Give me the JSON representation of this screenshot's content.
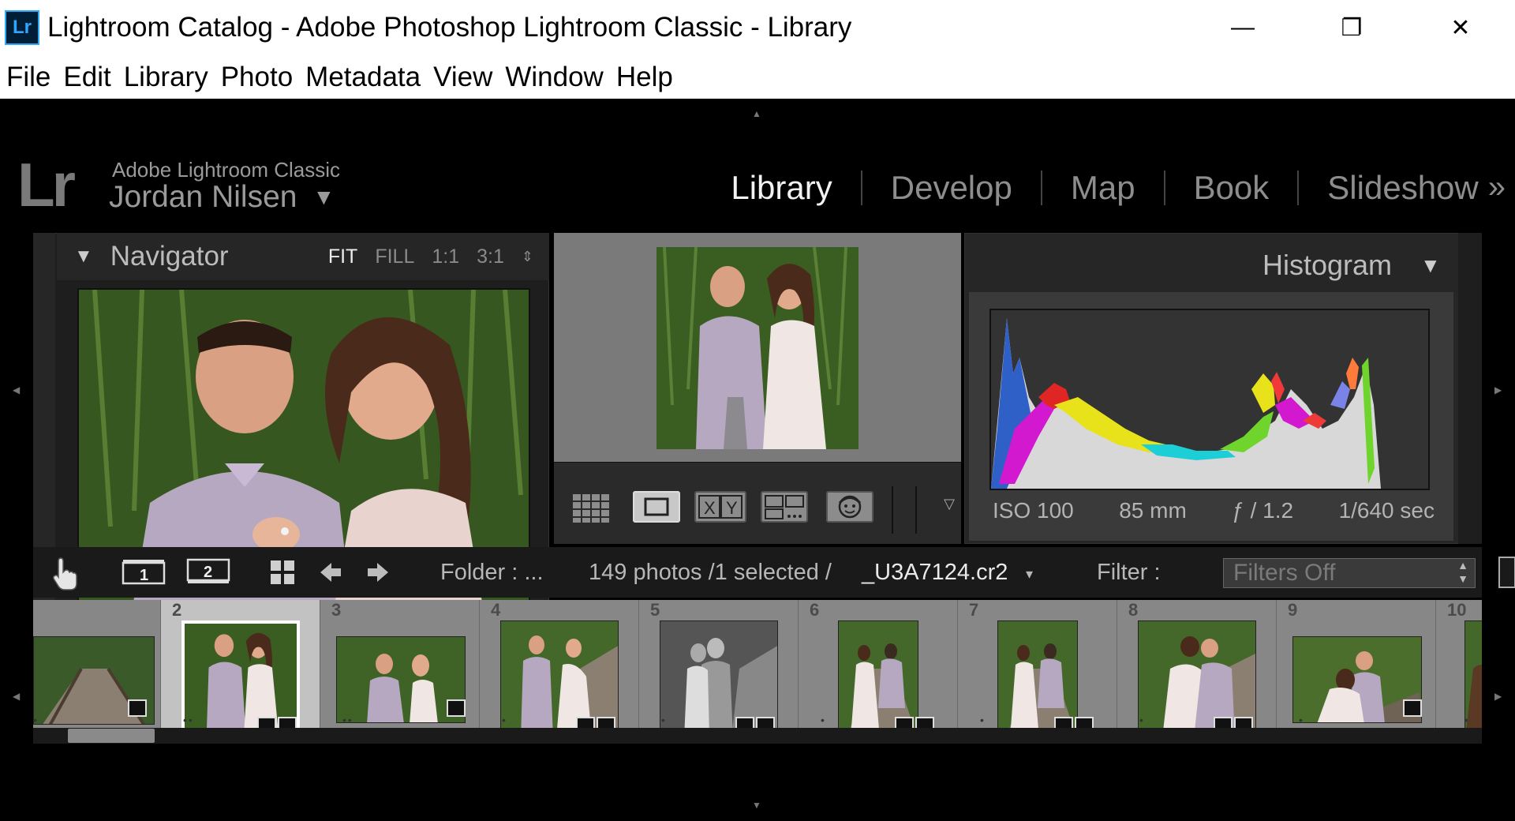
{
  "window": {
    "app_icon_text": "Lr",
    "title": "Lightroom Catalog - Adobe Photoshop Lightroom Classic - Library",
    "minimize": "—",
    "restore": "❐",
    "close": "✕"
  },
  "menu": [
    "File",
    "Edit",
    "Library",
    "Photo",
    "Metadata",
    "View",
    "Window",
    "Help"
  ],
  "identity": {
    "logo": "Lr",
    "product": "Adobe Lightroom Classic",
    "user": "Jordan Nilsen",
    "user_caret": "▼"
  },
  "modules": {
    "items": [
      "Library",
      "Develop",
      "Map",
      "Book",
      "Slideshow"
    ],
    "active": "Library",
    "more": "»"
  },
  "navigator": {
    "title": "Navigator",
    "collapse": "▼",
    "zoom": [
      "FIT",
      "FILL",
      "1:1",
      "3:1"
    ],
    "zoom_active": "FIT",
    "zoom_stepper": "⇕"
  },
  "histogram": {
    "title": "Histogram",
    "collapse": "▼",
    "iso": "ISO 100",
    "focal": "85 mm",
    "aperture": "ƒ / 1.2",
    "shutter": "1/640 sec"
  },
  "filmstrip_bar": {
    "page1": "1",
    "page2": "2",
    "folder": "Folder : ...",
    "count": "149 photos /1 selected /",
    "filename": "_U3A7124.cr2",
    "filename_caret": "▾",
    "filter_label": "Filter :",
    "filter_value": "Filters Off"
  },
  "filmstrip": {
    "cells": [
      {
        "num": "",
        "dots": "•",
        "badges": 1
      },
      {
        "num": "2",
        "dots": "••",
        "badges": 2,
        "selected": true
      },
      {
        "num": "3",
        "dots": "••",
        "badges": 1
      },
      {
        "num": "4",
        "dots": "•",
        "badges": 2
      },
      {
        "num": "5",
        "dots": "•",
        "badges": 2
      },
      {
        "num": "6",
        "dots": "•",
        "badges": 2
      },
      {
        "num": "7",
        "dots": "•",
        "badges": 2
      },
      {
        "num": "8",
        "dots": "•",
        "badges": 2
      },
      {
        "num": "9",
        "dots": "•",
        "badges": 1
      },
      {
        "num": "10",
        "dots": "•",
        "badges": 0
      }
    ]
  },
  "colors": {
    "background": "#000000",
    "panel": "#262626",
    "active_text": "#f2f2f2",
    "inactive_text": "#8d8d8d"
  }
}
